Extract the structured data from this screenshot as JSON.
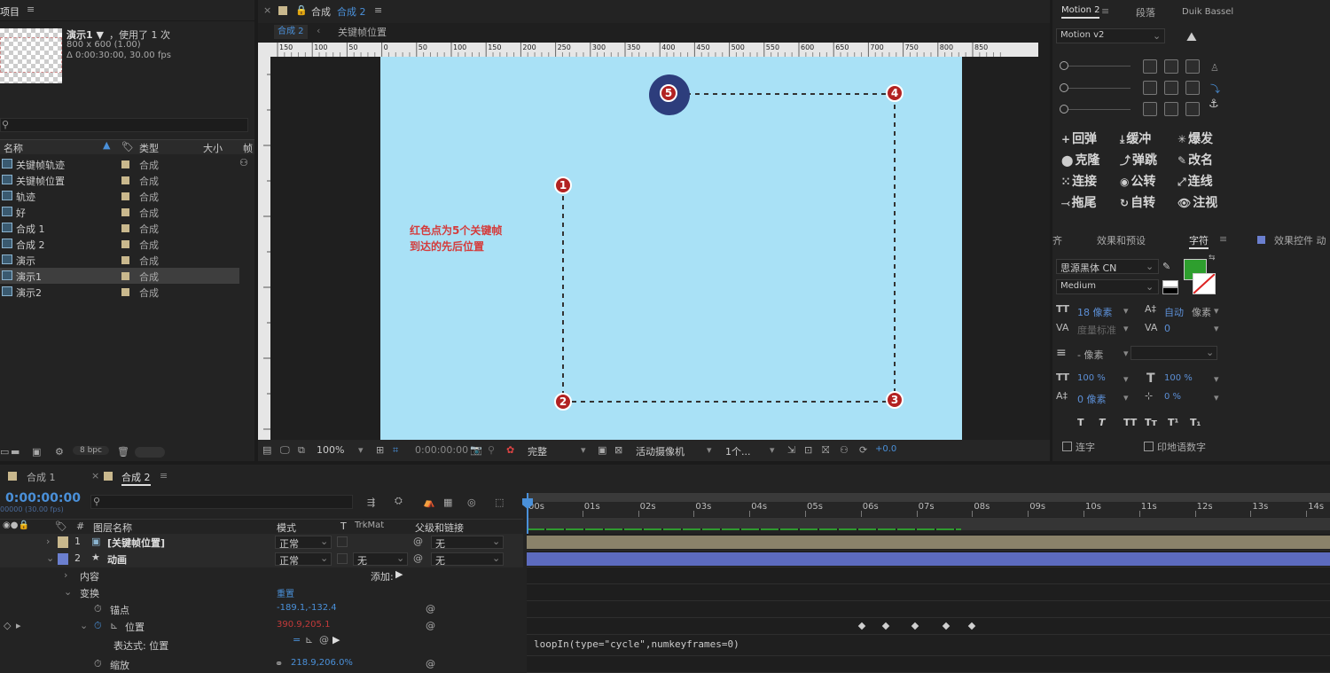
{
  "project": {
    "title": "项目",
    "comp_name": "演示1 ▼",
    "used": "，使用了 1 次",
    "size": "800 x 600 (1.00)",
    "duration": "Δ 0:00:30:00, 30.00 fps",
    "search_placeholder": "",
    "columns": [
      "名称",
      "类型",
      "大小",
      "帧"
    ],
    "items": [
      {
        "name": "关键帧轨迹",
        "type": "合成"
      },
      {
        "name": "关键帧位置",
        "type": "合成"
      },
      {
        "name": "轨迹",
        "type": "合成"
      },
      {
        "name": "好",
        "type": "合成"
      },
      {
        "name": "合成 1",
        "type": "合成"
      },
      {
        "name": "合成 2",
        "type": "合成"
      },
      {
        "name": "演示",
        "type": "合成"
      },
      {
        "name": "演示1",
        "type": "合成"
      },
      {
        "name": "演示2",
        "type": "合成"
      }
    ],
    "bpc": "8 bpc"
  },
  "comp": {
    "tab_label": "合成",
    "tab_active": "合成 2",
    "crumb_current": "合成 2",
    "crumb_next": "关键帧位置",
    "ruler_labels": [
      "150",
      "100",
      "50",
      "0",
      "50",
      "100",
      "150",
      "200",
      "250",
      "300",
      "350",
      "400",
      "450",
      "500",
      "550",
      "600",
      "650",
      "700",
      "750",
      "800",
      "850"
    ],
    "annotation_line1": "红色点为5个关键帧",
    "annotation_line2": "到达的先后位置",
    "markers": [
      "1",
      "2",
      "3",
      "4",
      "5"
    ],
    "zoom": "100%",
    "timecode": "0:00:00:00",
    "quality": "完整",
    "camera": "活动摄像机",
    "views": "1个...",
    "exposure": "+0.0"
  },
  "motion": {
    "tabs": [
      "Motion 2",
      "段落",
      "Duik Bassel"
    ],
    "version": "Motion v2",
    "commands": [
      {
        "icon": "+",
        "label": "回弹"
      },
      {
        "icon": "⤓",
        "label": "缓冲"
      },
      {
        "icon": "✳",
        "label": "爆发"
      },
      {
        "icon": "⬤",
        "label": "克隆"
      },
      {
        "icon": "⤴",
        "label": "弹跳"
      },
      {
        "icon": "✎",
        "label": "改名"
      },
      {
        "icon": "⁙",
        "label": "连接"
      },
      {
        "icon": "◉",
        "label": "公转"
      },
      {
        "icon": "⤢",
        "label": "连线"
      },
      {
        "icon": "⤙",
        "label": "拖尾"
      },
      {
        "icon": "↻",
        "label": "自转"
      },
      {
        "icon": "👁",
        "label": "注视"
      }
    ]
  },
  "character": {
    "tabs": [
      "齐",
      "效果和预设",
      "字符",
      "效果控件 动"
    ],
    "font": "思源黑体 CN",
    "style": "Medium",
    "size": "18 像素",
    "leading_auto": "自动",
    "leading_unit": "像素",
    "kerning": "度量标准",
    "tracking": "0",
    "stroke": "- 像素",
    "v_scale": "100 %",
    "h_scale": "100 %",
    "baseline": "0 像素",
    "tsume": "0 %",
    "fill_color": "#2e9f2e",
    "ligature": "连字",
    "hindi": "印地语数字"
  },
  "timeline": {
    "tabs": [
      "合成 1",
      "合成 2"
    ],
    "timecode": "0:00:00:00",
    "frames": "00000 (30.00 fps)",
    "columns": {
      "name": "图层名称",
      "mode": "模式",
      "t": "T",
      "trkmat": "TrkMat",
      "parent": "父级和链接"
    },
    "time_labels": [
      "00s",
      "01s",
      "02s",
      "03s",
      "04s",
      "05s",
      "06s",
      "07s",
      "08s",
      "09s",
      "10s",
      "11s",
      "12s",
      "13s",
      "14s"
    ],
    "layers": [
      {
        "num": "1",
        "name": "[关键帧位置]",
        "mode": "正常",
        "trk": "",
        "parent": "无",
        "color": "#c9b88d"
      },
      {
        "num": "2",
        "name": "动画",
        "mode": "正常",
        "trk": "无",
        "parent": "无",
        "color": "#6b7fcf"
      }
    ],
    "content": "内容",
    "add": "添加:",
    "transform": "变换",
    "reset": "重置",
    "anchor": {
      "label": "锚点",
      "value": "-189.1,-132.4"
    },
    "position": {
      "label": "位置",
      "value": "390.9,205.1"
    },
    "expression_label": "表达式: 位置",
    "expression": "loopIn(type=\"cycle\",numkeyframes=0)",
    "scale": {
      "label": "缩放",
      "value": "218.9,206.0%"
    }
  }
}
